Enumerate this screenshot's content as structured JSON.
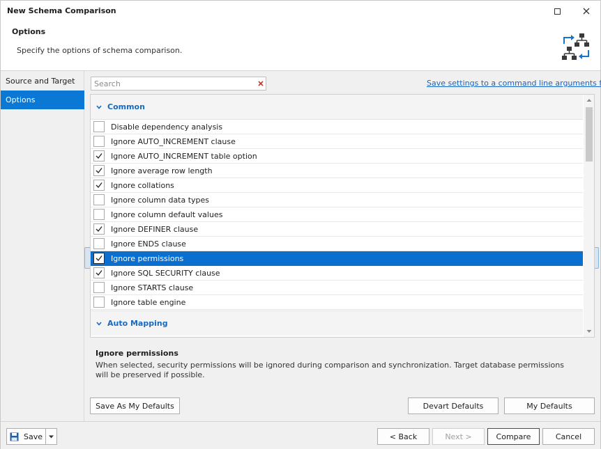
{
  "window": {
    "title": "New Schema Comparison"
  },
  "header": {
    "title": "Options",
    "subtitle": "Specify the options of schema comparison."
  },
  "sidebar": {
    "items": [
      {
        "label": "Source and Target",
        "selected": false
      },
      {
        "label": "Options",
        "selected": true
      }
    ]
  },
  "search": {
    "placeholder": "Search",
    "value": ""
  },
  "command_link": "Save settings to a command line arguments file...",
  "groups": [
    {
      "name": "Common",
      "expanded": true
    },
    {
      "name": "Auto Mapping",
      "expanded": true
    }
  ],
  "options": [
    {
      "label": "Disable dependency analysis",
      "checked": false
    },
    {
      "label": "Ignore AUTO_INCREMENT clause",
      "checked": false
    },
    {
      "label": "Ignore AUTO_INCREMENT table option",
      "checked": true
    },
    {
      "label": "Ignore average row length",
      "checked": true
    },
    {
      "label": "Ignore collations",
      "checked": true
    },
    {
      "label": "Ignore column data types",
      "checked": false
    },
    {
      "label": "Ignore column default values",
      "checked": false
    },
    {
      "label": "Ignore DEFINER clause",
      "checked": true
    },
    {
      "label": "Ignore ENDS clause",
      "checked": false
    },
    {
      "label": "Ignore permissions",
      "checked": true,
      "selected": true
    },
    {
      "label": "Ignore SQL SECURITY clause",
      "checked": true
    },
    {
      "label": "Ignore STARTS clause",
      "checked": false
    },
    {
      "label": "Ignore table engine",
      "checked": false
    }
  ],
  "description": {
    "title": "Ignore permissions",
    "text": "When selected, security permissions will be ignored during comparison and synchronization. Target database permissions will be preserved if possible."
  },
  "buttons": {
    "save_as_defaults": "Save As My Defaults",
    "devart_defaults": "Devart Defaults",
    "my_defaults": "My Defaults",
    "save": "Save",
    "back": "< Back",
    "next": "Next >",
    "compare": "Compare",
    "cancel": "Cancel"
  },
  "colors": {
    "accent": "#0a78d4",
    "group_text": "#1769c2",
    "link": "#1765c0"
  }
}
